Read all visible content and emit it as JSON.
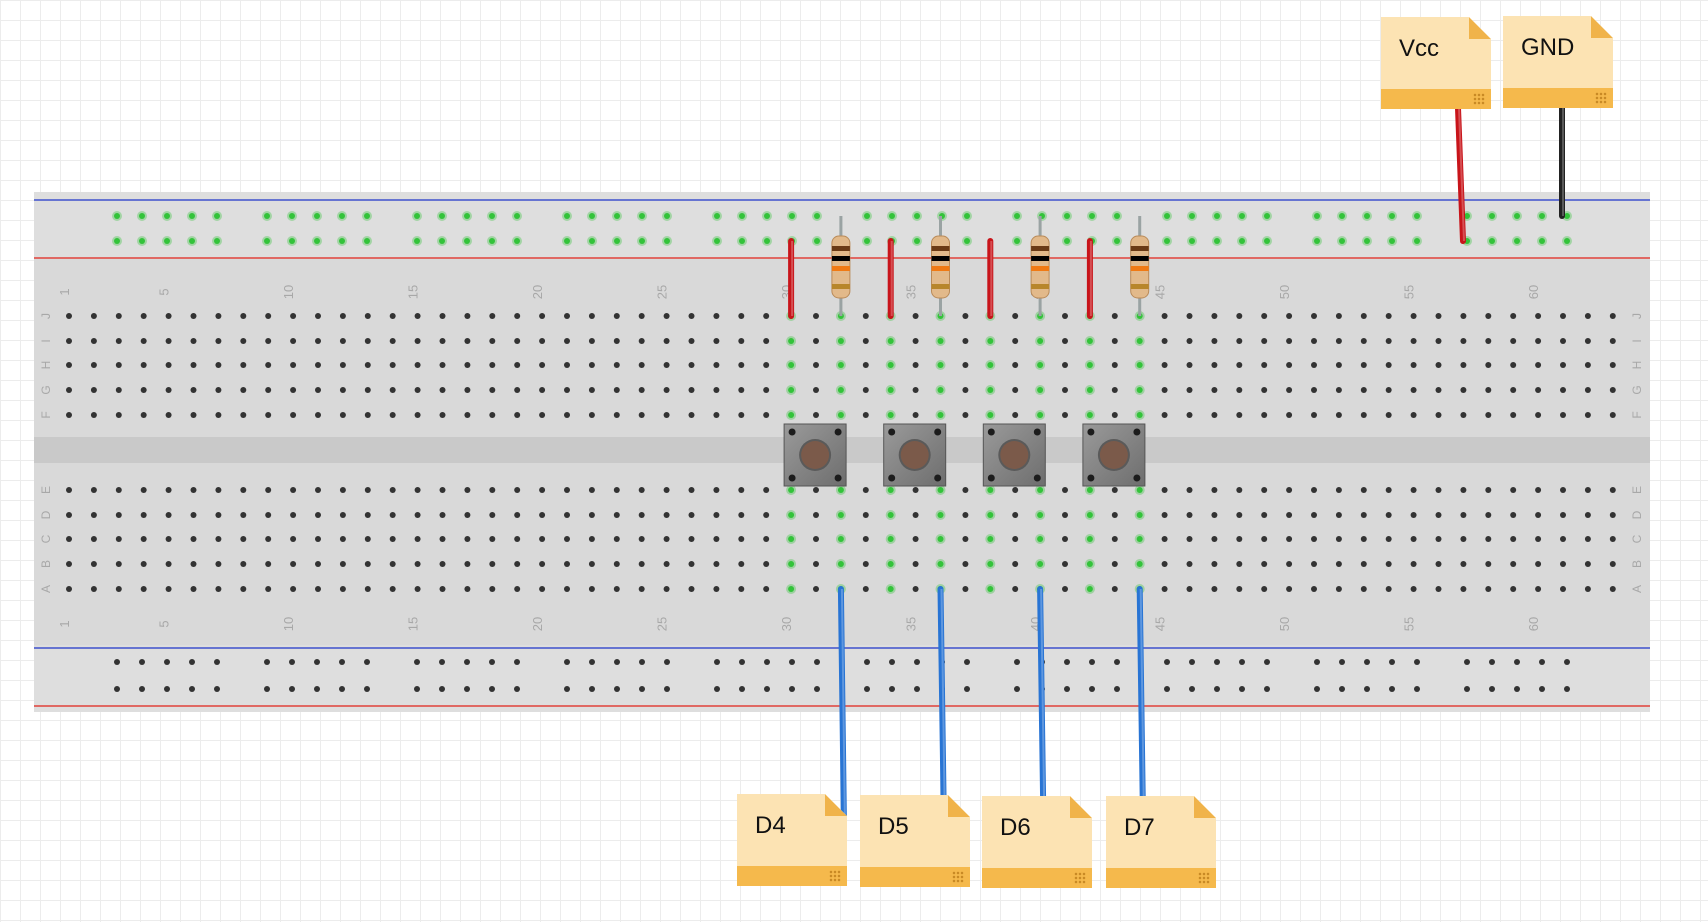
{
  "labels": {
    "vcc": "Vcc",
    "gnd": "GND",
    "d4": "D4",
    "d5": "D5",
    "d6": "D6",
    "d7": "D7"
  },
  "breadboard": {
    "column_numbers": [
      "1",
      "5",
      "10",
      "15",
      "20",
      "25",
      "30",
      "35",
      "40",
      "45",
      "50",
      "55",
      "60"
    ],
    "top_rows": [
      "J",
      "I",
      "H",
      "G",
      "F"
    ],
    "bottom_rows": [
      "E",
      "D",
      "C",
      "B",
      "A"
    ]
  },
  "colors": {
    "board": "#d9d9d9",
    "rail_red": "#e2231a",
    "rail_blue": "#1f35c9",
    "hole": "#333333",
    "hole_active": "#33c33a",
    "wire_red": "#c8141a",
    "wire_black": "#222222",
    "wire_blue": "#2874d4",
    "note": "#fce3b3",
    "note_band": "#f5b94c"
  }
}
